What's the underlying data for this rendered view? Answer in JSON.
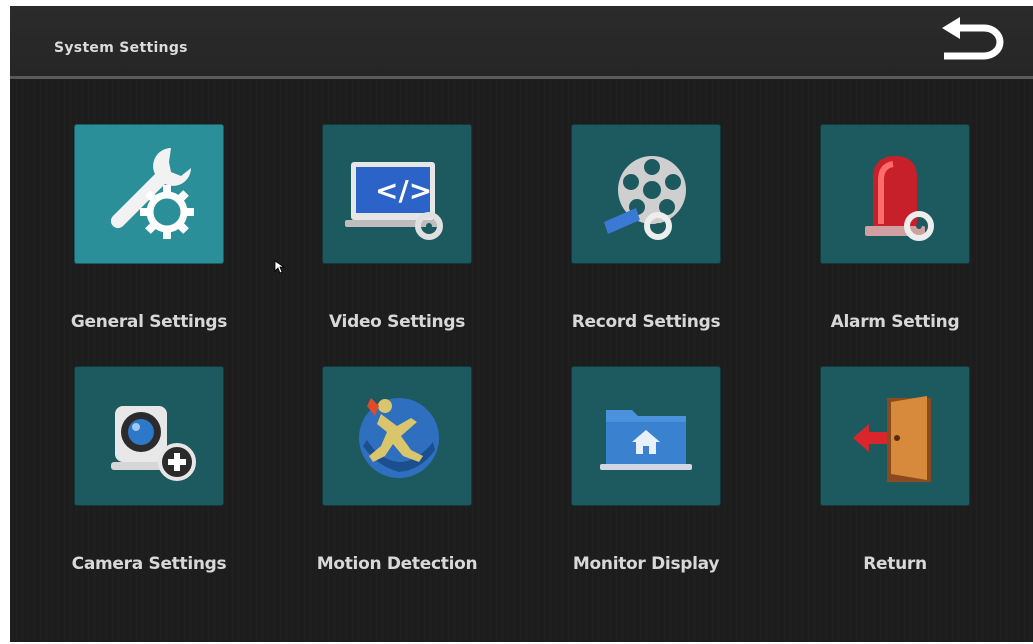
{
  "header": {
    "title": "System Settings"
  },
  "tiles": [
    {
      "label": "General Settings",
      "icon": "wrench-gear-icon",
      "selected": true
    },
    {
      "label": "Video Settings",
      "icon": "monitor-code-gear-icon",
      "selected": false
    },
    {
      "label": "Record Settings",
      "icon": "film-reel-gear-icon",
      "selected": false
    },
    {
      "label": "Alarm Setting",
      "icon": "alarm-siren-gear-icon",
      "selected": false
    },
    {
      "label": "Camera Settings",
      "icon": "webcam-plus-icon",
      "selected": false
    },
    {
      "label": "Motion Detection",
      "icon": "running-figure-icon",
      "selected": false
    },
    {
      "label": "Monitor Display",
      "icon": "home-folder-display-icon",
      "selected": false
    },
    {
      "label": "Return",
      "icon": "exit-door-arrow-icon",
      "selected": false
    }
  ],
  "colors": {
    "background": "#1d1d1d",
    "tile": "#1c5a60",
    "tile_selected": "#2a8f98",
    "text": "#d8d8d8"
  }
}
